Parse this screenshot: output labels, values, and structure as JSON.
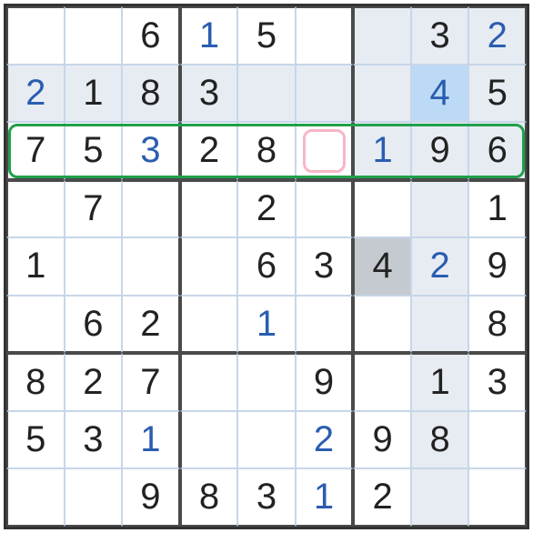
{
  "sudoku": {
    "grid": [
      [
        {
          "v": "",
          "given": false
        },
        {
          "v": "",
          "given": false
        },
        {
          "v": "6",
          "given": true
        },
        {
          "v": "1",
          "given": false
        },
        {
          "v": "5",
          "given": true
        },
        {
          "v": "",
          "given": false
        },
        {
          "v": "",
          "given": false
        },
        {
          "v": "3",
          "given": true
        },
        {
          "v": "2",
          "given": false
        }
      ],
      [
        {
          "v": "2",
          "given": false
        },
        {
          "v": "1",
          "given": true
        },
        {
          "v": "8",
          "given": true
        },
        {
          "v": "3",
          "given": true
        },
        {
          "v": "",
          "given": false
        },
        {
          "v": "",
          "given": false
        },
        {
          "v": "",
          "given": false
        },
        {
          "v": "4",
          "given": false
        },
        {
          "v": "5",
          "given": true
        }
      ],
      [
        {
          "v": "7",
          "given": true
        },
        {
          "v": "5",
          "given": true
        },
        {
          "v": "3",
          "given": false
        },
        {
          "v": "2",
          "given": true
        },
        {
          "v": "8",
          "given": true
        },
        {
          "v": "",
          "given": false
        },
        {
          "v": "1",
          "given": false
        },
        {
          "v": "9",
          "given": true
        },
        {
          "v": "6",
          "given": true
        }
      ],
      [
        {
          "v": "",
          "given": false
        },
        {
          "v": "7",
          "given": true
        },
        {
          "v": "",
          "given": false
        },
        {
          "v": "",
          "given": false
        },
        {
          "v": "2",
          "given": true
        },
        {
          "v": "",
          "given": false
        },
        {
          "v": "",
          "given": false
        },
        {
          "v": "",
          "given": false
        },
        {
          "v": "1",
          "given": true
        }
      ],
      [
        {
          "v": "1",
          "given": true
        },
        {
          "v": "",
          "given": false
        },
        {
          "v": "",
          "given": false
        },
        {
          "v": "",
          "given": false
        },
        {
          "v": "6",
          "given": true
        },
        {
          "v": "3",
          "given": true
        },
        {
          "v": "4",
          "given": true
        },
        {
          "v": "2",
          "given": false
        },
        {
          "v": "9",
          "given": true
        }
      ],
      [
        {
          "v": "",
          "given": false
        },
        {
          "v": "6",
          "given": true
        },
        {
          "v": "2",
          "given": true
        },
        {
          "v": "",
          "given": false
        },
        {
          "v": "1",
          "given": false
        },
        {
          "v": "",
          "given": false
        },
        {
          "v": "",
          "given": false
        },
        {
          "v": "",
          "given": false
        },
        {
          "v": "8",
          "given": true
        }
      ],
      [
        {
          "v": "8",
          "given": true
        },
        {
          "v": "2",
          "given": true
        },
        {
          "v": "7",
          "given": true
        },
        {
          "v": "",
          "given": false
        },
        {
          "v": "",
          "given": false
        },
        {
          "v": "9",
          "given": true
        },
        {
          "v": "",
          "given": false
        },
        {
          "v": "1",
          "given": true
        },
        {
          "v": "3",
          "given": true
        }
      ],
      [
        {
          "v": "5",
          "given": true
        },
        {
          "v": "3",
          "given": true
        },
        {
          "v": "1",
          "given": false
        },
        {
          "v": "",
          "given": false
        },
        {
          "v": "",
          "given": false
        },
        {
          "v": "2",
          "given": false
        },
        {
          "v": "9",
          "given": true
        },
        {
          "v": "8",
          "given": true
        },
        {
          "v": "",
          "given": false
        }
      ],
      [
        {
          "v": "",
          "given": false
        },
        {
          "v": "",
          "given": false
        },
        {
          "v": "9",
          "given": true
        },
        {
          "v": "8",
          "given": true
        },
        {
          "v": "3",
          "given": true
        },
        {
          "v": "1",
          "given": false
        },
        {
          "v": "2",
          "given": true
        },
        {
          "v": "",
          "given": false
        },
        {
          "v": "",
          "given": false
        }
      ]
    ],
    "shaded_cells": [
      [
        1,
        0
      ],
      [
        1,
        1
      ],
      [
        1,
        2
      ],
      [
        1,
        3
      ],
      [
        1,
        4
      ],
      [
        1,
        5
      ],
      [
        1,
        6
      ],
      [
        1,
        8
      ],
      [
        0,
        7
      ],
      [
        2,
        7
      ],
      [
        3,
        7
      ],
      [
        4,
        7
      ],
      [
        5,
        7
      ],
      [
        6,
        7
      ],
      [
        7,
        7
      ],
      [
        8,
        7
      ],
      [
        0,
        6
      ],
      [
        0,
        8
      ],
      [
        2,
        6
      ],
      [
        2,
        8
      ]
    ],
    "selected_bg": [
      1,
      7
    ],
    "dim_bg": [
      4,
      6
    ],
    "highlight_row": 2,
    "selected_cell": [
      2,
      5
    ],
    "colors": {
      "given": "#222222",
      "user": "#2a5db0",
      "highlight_border": "#1fa04a",
      "select_border": "#f7b6c6",
      "shaded_bg": "#e7ecf3",
      "selected_bg": "#bcdaf5"
    }
  }
}
